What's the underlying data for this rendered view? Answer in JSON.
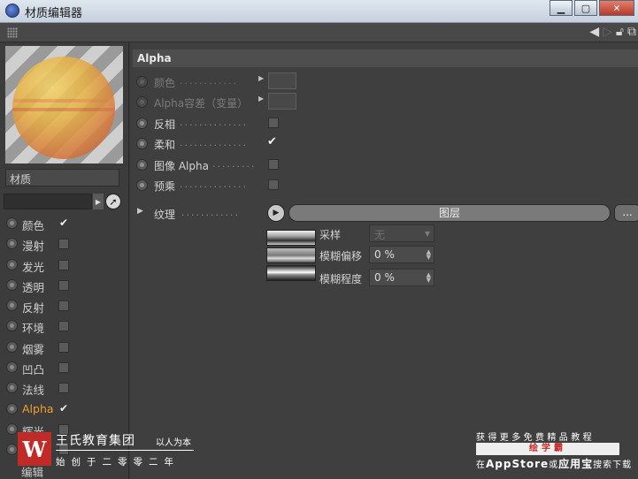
{
  "window": {
    "title": "材质编辑器",
    "buttons": {
      "minimize": "▁",
      "maximize": "▢",
      "close": "✕"
    }
  },
  "toolbar": {
    "icons": [
      "grip-icon",
      "back-arrow-icon",
      "forward-arrow-icon",
      "lock-icon",
      "new-window-icon"
    ]
  },
  "left": {
    "material_name": "材质",
    "channels": [
      {
        "label": "颜色",
        "checked": true,
        "active": false
      },
      {
        "label": "漫射",
        "checked": false,
        "active": false
      },
      {
        "label": "发光",
        "checked": false,
        "active": false
      },
      {
        "label": "透明",
        "checked": false,
        "active": false
      },
      {
        "label": "反射",
        "checked": false,
        "active": false
      },
      {
        "label": "环境",
        "checked": false,
        "active": false
      },
      {
        "label": "烟雾",
        "checked": false,
        "active": false
      },
      {
        "label": "凹凸",
        "checked": false,
        "active": false
      },
      {
        "label": "法线",
        "checked": false,
        "active": false
      },
      {
        "label": "Alpha",
        "checked": true,
        "active": true
      },
      {
        "label": "辉光",
        "checked": false,
        "active": false
      },
      {
        "label": "置换",
        "checked": false,
        "active": false
      }
    ],
    "bottom_label": "编辑"
  },
  "alpha": {
    "section_title": "Alpha",
    "props": {
      "color": {
        "label": "颜色",
        "dots": "............"
      },
      "delta": {
        "label": "Alpha容差（变量）",
        "dots": "."
      },
      "invert": {
        "label": "反相",
        "dots": "..............",
        "checked": false
      },
      "soft": {
        "label": "柔和",
        "dots": "..............",
        "checked": true
      },
      "image_alpha": {
        "label": "图像 Alpha",
        "dots": ".........",
        "checked": false
      },
      "premultiplied": {
        "label": "预乘",
        "dots": "..............",
        "checked": false
      }
    },
    "texture": {
      "label": "纹理",
      "dots": "............",
      "layer_button": "图层",
      "more_button": "...",
      "sampling_label": "采样",
      "sampling_value": "无",
      "blur_offset_label": "模糊偏移",
      "blur_offset_value": "0 %",
      "blur_scale_label": "模糊程度",
      "blur_scale_value": "0 %"
    }
  },
  "watermark": {
    "logo_letter": "W",
    "company": "王氏教育集团",
    "slogan": "以人为本",
    "since": "始创于二零零二年",
    "right_line1": "获得更多免费精品教程",
    "right_brand": "绘学霸",
    "right_line3_pre": "在",
    "right_appstore": "AppStore",
    "right_or": "或",
    "right_yyb": "应用宝",
    "right_line3_post": "搜索下载"
  },
  "colors": {
    "panel_bg": "#3f3f3f",
    "active_channel": "#f0a030",
    "brand_red": "#c22a27"
  }
}
